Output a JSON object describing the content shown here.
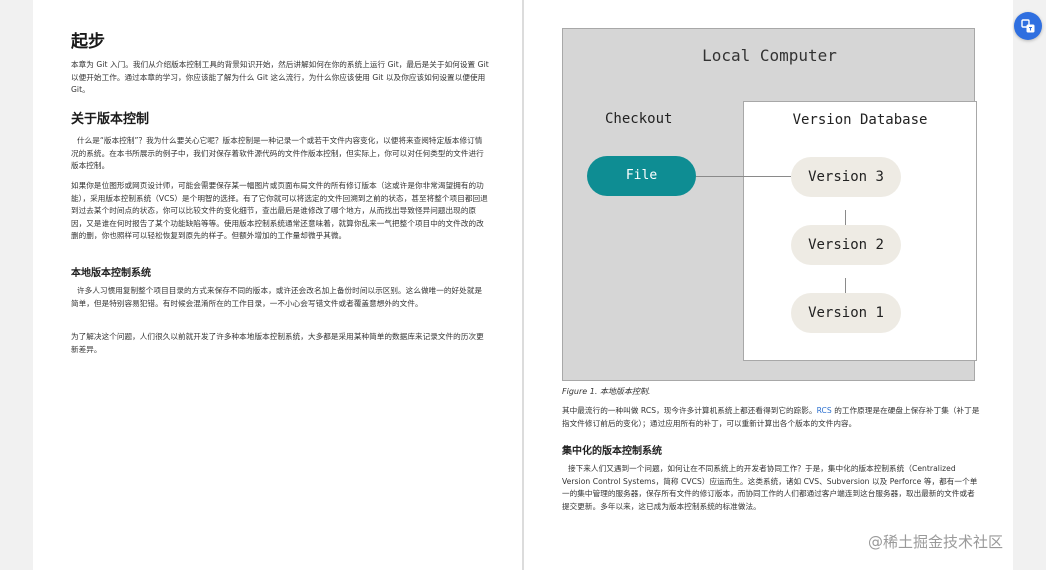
{
  "left": {
    "title": "起步",
    "intro": "本章为 Git 入门。我们从介绍版本控制工具的背景知识开始，然后讲解如何在你的系统上运行 Git，最后是关于如何设置 Git 以便开始工作。通过本章的学习，你应该能了解为什么 Git 这么流行，为什么你应该使用 Git 以及你应该如何设置以便使用 Git。",
    "section_title": "关于版本控制",
    "p1": "什么是“版本控制”？我为什么要关心它呢？版本控制是一种记录一个或若干文件内容变化，以便将来查阅特定版本修订情况的系统。在本书所展示的例子中，我们对保存着软件源代码的文件作版本控制，但实际上，你可以对任何类型的文件进行版本控制。",
    "p2": "如果你是位图形或网页设计师，可能会需要保存某一幅图片或页面布局文件的所有修订版本（这或许是你非常渴望拥有的功能），采用版本控制系统（VCS）是个明智的选择。有了它你就可以将选定的文件回溯到之前的状态，甚至将整个项目都回退到过去某个时间点的状态，你可以比较文件的变化细节，查出最后是谁修改了哪个地方，从而找出导致怪异问题出现的原因，又是谁在何时报告了某个功能缺陷等等。使用版本控制系统通常还意味着，就算你乱来一气把整个项目中的文件改的改删的删，你也照样可以轻松恢复到原先的样子。但额外增加的工作量却微乎其微。",
    "subsection_title": "本地版本控制系统",
    "p3": "许多人习惯用复制整个项目目录的方式来保存不同的版本，或许还会改名加上备份时间以示区别。这么做唯一的好处就是简单，但是特别容易犯错。有时候会混淆所在的工作目录，一不小心会写错文件或者覆盖意想外的文件。",
    "p4": "为了解决这个问题，人们很久以前就开发了许多种本地版本控制系统，大多都是采用某种简单的数据库来记录文件的历次更新差异。"
  },
  "figure": {
    "title": "Local Computer",
    "checkout": "Checkout",
    "database": "Version Database",
    "file": "File",
    "versions": [
      "Version 3",
      "Version 2",
      "Version 1"
    ],
    "caption": "Figure 1. 本地版本控制."
  },
  "right": {
    "p5_before": "其中最流行的一种叫做 RCS，现今许多计算机系统上都还看得到它的踪影。",
    "p5_link": "RCS",
    "p5_after": " 的工作原理是在硬盘上保存补丁集（补丁是指文件修订前后的变化）；通过应用所有的补丁，可以重新计算出各个版本的文件内容。",
    "subsection_title": "集中化的版本控制系统",
    "p6": "接下来人们又遇到一个问题，如何让在不同系统上的开发者协同工作？于是，集中化的版本控制系统（Centralized Version Control Systems，简称 CVCS）应运而生。这类系统，诸如 CVS、Subversion 以及 Perforce 等，都有一个单一的集中管理的服务器，保存所有文件的修订版本，而协同工作的人们都通过客户端连到这台服务器，取出最新的文件或者提交更新。多年以来，这已成为版本控制系统的标准做法。"
  },
  "watermark": "@稀土掘金技术社区",
  "colors": {
    "file_pill": "#0e8d93",
    "version_pill": "#eeebe4",
    "figure_bg": "#d6d6d6",
    "link": "#2a6fcf",
    "float_button": "#2f6fe0"
  },
  "float_button_icon": "translate-icon"
}
